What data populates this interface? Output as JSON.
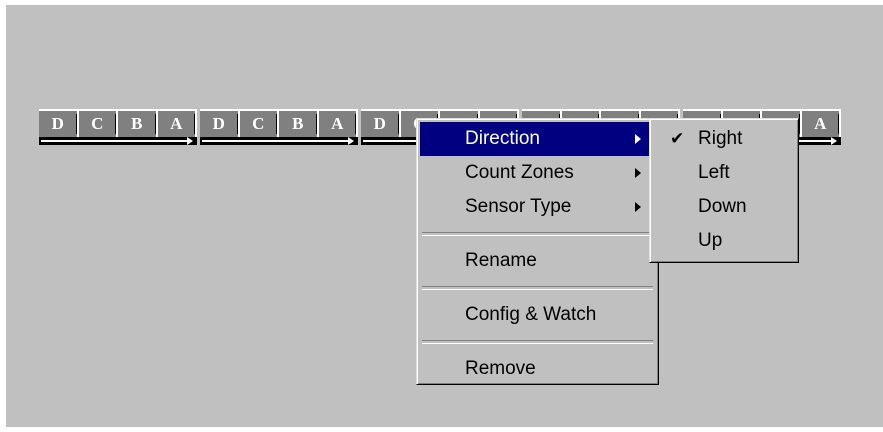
{
  "sensors": [
    {
      "cells": [
        "D",
        "C",
        "B",
        "A"
      ]
    },
    {
      "cells": [
        "D",
        "C",
        "B",
        "A"
      ]
    },
    {
      "cells": [
        "D",
        "C",
        "B",
        "A"
      ]
    },
    {
      "cells": [
        "D",
        "C",
        "B",
        "A"
      ]
    },
    {
      "cells": [
        "D",
        "C",
        "B",
        "A"
      ]
    }
  ],
  "context_menu": {
    "items": [
      {
        "label": "Direction",
        "has_submenu": true,
        "selected": true
      },
      {
        "label": "Count Zones",
        "has_submenu": true
      },
      {
        "label": "Sensor Type",
        "has_submenu": true
      },
      {
        "label": "Rename"
      },
      {
        "label": "Config & Watch"
      },
      {
        "label": "Remove"
      }
    ]
  },
  "direction_submenu": {
    "items": [
      {
        "label": "Right",
        "checked": true,
        "check_glyph": "✔"
      },
      {
        "label": "Left"
      },
      {
        "label": "Down"
      },
      {
        "label": "Up"
      }
    ]
  },
  "colors": {
    "background": "#c0c0c0",
    "selection": "#000080",
    "sensor_fill": "#808080"
  }
}
